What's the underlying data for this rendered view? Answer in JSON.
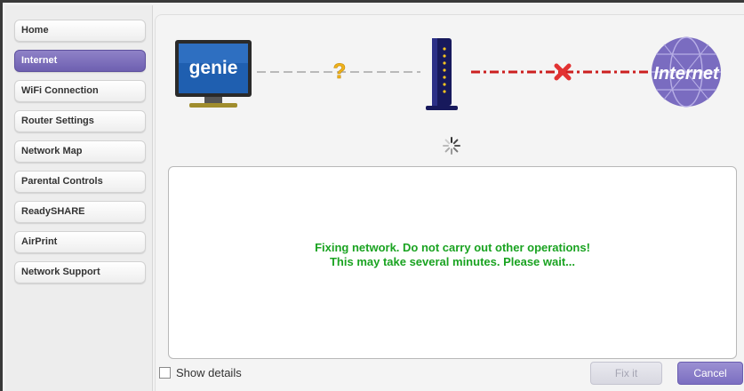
{
  "sidebar": {
    "items": [
      {
        "label": "Home",
        "active": false
      },
      {
        "label": "Internet",
        "active": true
      },
      {
        "label": "WiFi Connection",
        "active": false
      },
      {
        "label": "Router Settings",
        "active": false
      },
      {
        "label": "Network Map",
        "active": false
      },
      {
        "label": "Parental Controls",
        "active": false
      },
      {
        "label": "ReadySHARE",
        "active": false
      },
      {
        "label": "AirPrint",
        "active": false
      },
      {
        "label": "Network Support",
        "active": false
      }
    ]
  },
  "diagram": {
    "computer_label": "genie",
    "internet_label": "Internet",
    "link_computer_router_status": "unknown",
    "link_router_internet_status": "failed",
    "colors": {
      "accent": "#7a6cc0",
      "failed_link": "#cc1f1f",
      "unknown_link": "#b9b9b9",
      "question": "#f0b21a"
    }
  },
  "status": {
    "line1": "Fixing network. Do not carry out other operations!",
    "line2": "This may take several minutes. Please wait...",
    "color": "#1aa321"
  },
  "footer": {
    "show_details_label": "Show details",
    "show_details_checked": false,
    "fix_label": "Fix it",
    "fix_enabled": false,
    "cancel_label": "Cancel"
  }
}
